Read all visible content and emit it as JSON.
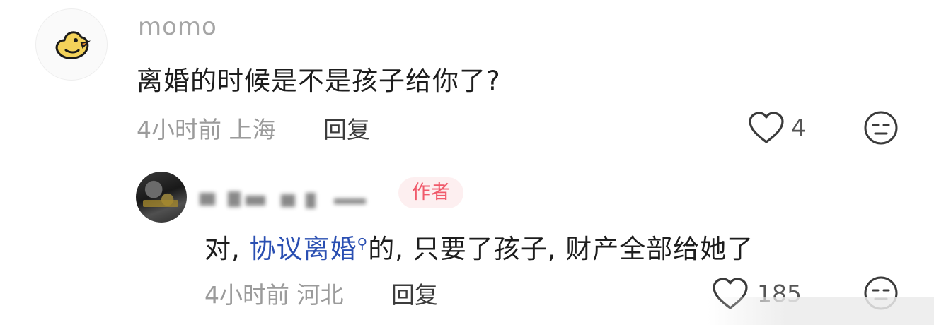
{
  "comment": {
    "username": "momo",
    "text": "离婚的时候是不是孩子给你了?",
    "time": "4小时前",
    "location": "上海",
    "reply_label": "回复",
    "likes": "4"
  },
  "reply": {
    "author_badge": "作者",
    "text_before": "对, ",
    "link_text": "协议离婚",
    "search_glyph": "⚲",
    "text_after": "的, 只要了孩子, 财产全部给她了",
    "time": "4小时前",
    "location": "河北",
    "reply_label": "回复",
    "likes": "185"
  }
}
